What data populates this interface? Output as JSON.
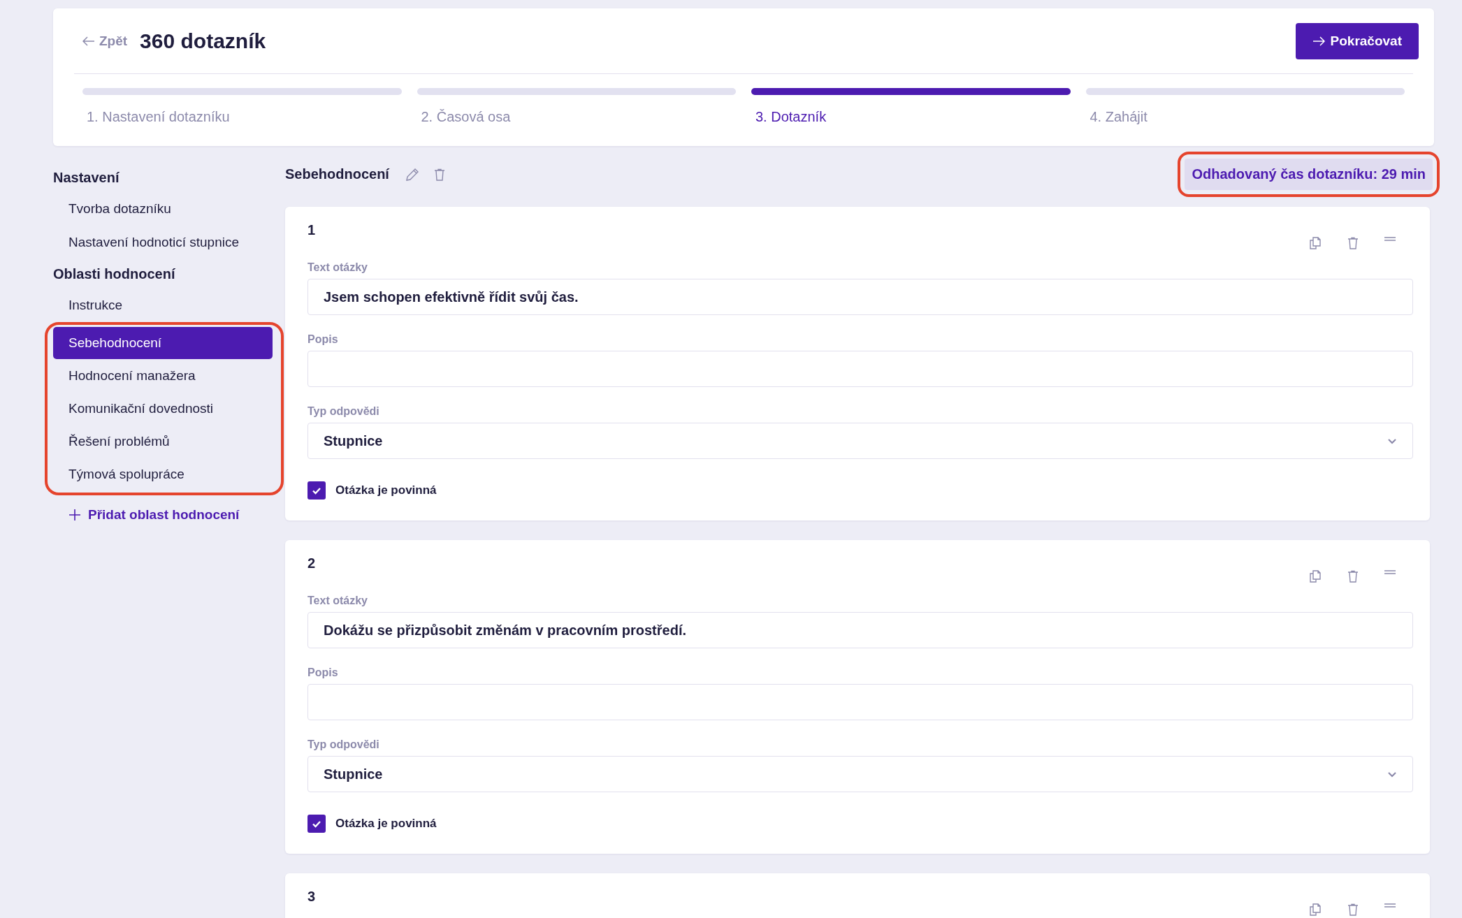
{
  "header": {
    "back_label": "Zpět",
    "title": "360 dotazník",
    "continue_label": "Pokračovat"
  },
  "steps": [
    {
      "label": "1. Nastavení dotazníku",
      "selected": false
    },
    {
      "label": "2. Časová osa",
      "selected": false
    },
    {
      "label": "3. Dotazník",
      "selected": true
    },
    {
      "label": "4. Zahájit",
      "selected": false
    }
  ],
  "sidebar": {
    "groups": [
      {
        "title": "Nastavení",
        "items": [
          {
            "label": "Tvorba dotazníku",
            "selected": false,
            "highlighted": false
          },
          {
            "label": "Nastavení hodnoticí stupnice",
            "selected": false,
            "highlighted": false
          }
        ]
      },
      {
        "title": "Oblasti hodnocení",
        "items": [
          {
            "label": "Instrukce",
            "selected": false,
            "highlighted": false
          },
          {
            "label": "Sebehodnocení",
            "selected": true,
            "highlighted": true
          },
          {
            "label": "Hodnocení manažera",
            "selected": false,
            "highlighted": true
          },
          {
            "label": "Komunikační dovednosti",
            "selected": false,
            "highlighted": true
          },
          {
            "label": "Řešení problémů",
            "selected": false,
            "highlighted": true
          },
          {
            "label": "Týmová spolupráce",
            "selected": false,
            "highlighted": true
          }
        ]
      }
    ],
    "add_label": "Přidat oblast hodnocení"
  },
  "section": {
    "title": "Sebehodnocení",
    "estimate": "Odhadovaný čas dotazníku: 29 min",
    "estimate_highlighted": true
  },
  "questions": [
    {
      "number": "1",
      "text_label": "Text otázky",
      "text": "Jsem schopen efektivně řídit svůj čas.",
      "description_label": "Popis",
      "type_label": "Typ odpovědi",
      "type": "Stupnice",
      "required_label": "Otázka je povinná",
      "required": true
    },
    {
      "number": "2",
      "text_label": "Text otázky",
      "text": "Dokážu se přizpůsobit změnám v pracovním prostředí.",
      "description_label": "Popis",
      "type_label": "Typ odpovědi",
      "type": "Stupnice",
      "required_label": "Otázka je povinná",
      "required": true
    },
    {
      "number": "3"
    }
  ]
}
